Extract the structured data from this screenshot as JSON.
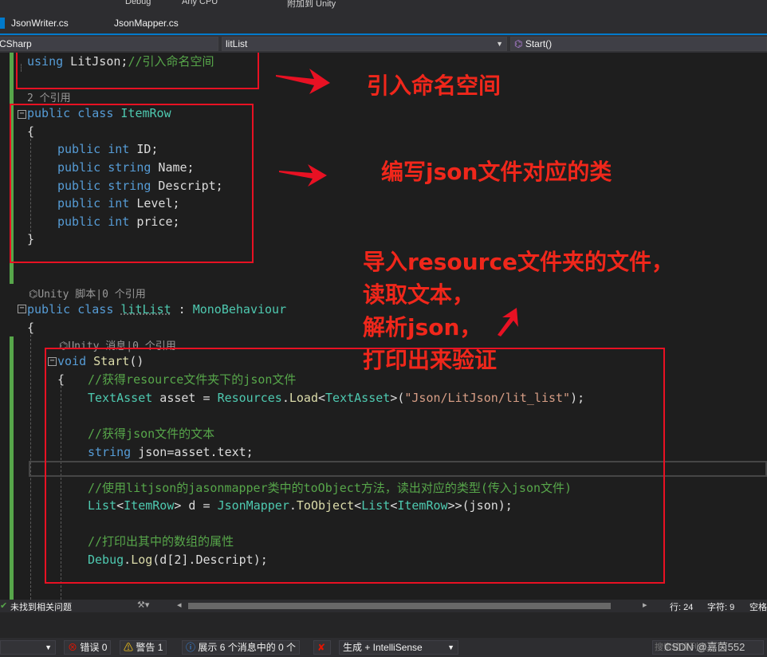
{
  "toolbar": {
    "config": "Debug",
    "platform": "Any CPU",
    "attach": "附加到 Unity"
  },
  "tabs": [
    {
      "label": "JsonWriter.cs"
    },
    {
      "label": "JsonMapper.cs"
    }
  ],
  "nav": {
    "project": "CSharp",
    "class": "litList",
    "member": "Start()"
  },
  "code": {
    "l1_kw": "using",
    "l1_ns": " LitJson;",
    "l1_cm": "//引入命名空间",
    "ref_count": "2 个引用",
    "itemrow_head": [
      "public",
      " class ",
      "ItemRow"
    ],
    "brace_open": "{",
    "brace_close": "}",
    "fields": [
      {
        "kw": "public",
        "ty": "int",
        "name": " ID;"
      },
      {
        "kw": "public",
        "ty": "string",
        "name": " Name;"
      },
      {
        "kw": "public",
        "ty": "string",
        "name": " Descript;"
      },
      {
        "kw": "public",
        "ty": "int",
        "name": " Level;"
      },
      {
        "kw": "public",
        "ty": "int",
        "name": " price;"
      }
    ],
    "lens_unity_script": "⌬Unity 脚本|0 个引用",
    "litlist_head": [
      "public",
      " class ",
      "litList",
      " : ",
      "MonoBehaviour"
    ],
    "lens_unity_msg": "⌬Unity 消息|0 个引用",
    "start_sig": [
      "void",
      " Start",
      "()"
    ],
    "cm1": "//获得resource文件夹下的json文件",
    "line_asset": {
      "ty": "TextAsset",
      "a": " asset = ",
      "ty2": "Resources",
      "b": ".",
      "fn": "Load",
      "c": "<",
      "ty3": "TextAsset",
      "d": ">(",
      "str": "\"Json/LitJson/lit_list\"",
      "e": ");"
    },
    "cm2": "//获得json文件的文本",
    "line_json": {
      "kw": "string",
      "rest": " json=asset.text;"
    },
    "cm3": "//使用litjson的jasonmapper类中的toObject方法，读出对应的类型(传入json文件)",
    "line_list": {
      "ty": "List",
      "a": "<",
      "ty2": "ItemRow",
      "b": "> d = ",
      "ty3": "JsonMapper",
      "c": ".",
      "fn": "ToObject",
      "d": "<",
      "ty4": "List",
      "e": "<",
      "ty5": "ItemRow",
      "f": ">>(json);"
    },
    "cm4": "//打印出其中的数组的属性",
    "line_debug": {
      "ty": "Debug",
      "a": ".",
      "fn": "Log",
      "b": "(d[2].Descript);"
    }
  },
  "annotations": {
    "a1": "引入命名空间",
    "a2": "编写json文件对应的类",
    "a3_lines": [
      "导入resource文件夹的文件，",
      "读取文本，",
      "解析json，",
      "打印出来验证"
    ]
  },
  "status": {
    "issues": "未找到相关问题",
    "line": "行: 24",
    "col": "字符: 9",
    "spaces": "空格"
  },
  "errorlist": {
    "errors": "错误 0",
    "warnings": "警告 1",
    "messages": "展示 6 个消息中的 0 个",
    "build": "生成 + IntelliSense"
  },
  "watermark": "CSDN @嘉茵552",
  "search_placeholder": "搜索错误列表"
}
